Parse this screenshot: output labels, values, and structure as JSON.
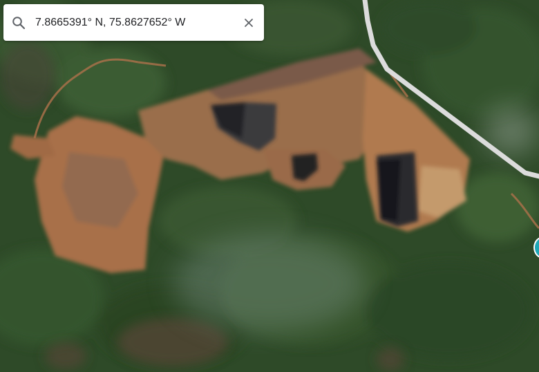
{
  "search": {
    "query": "7.8665391° N, 75.8627652° W",
    "search_icon": "search-icon",
    "clear_icon": "close-icon"
  },
  "map": {
    "view": "satellite",
    "road_color": "#dcdcdc",
    "marker_color": "#1fa7b6"
  }
}
